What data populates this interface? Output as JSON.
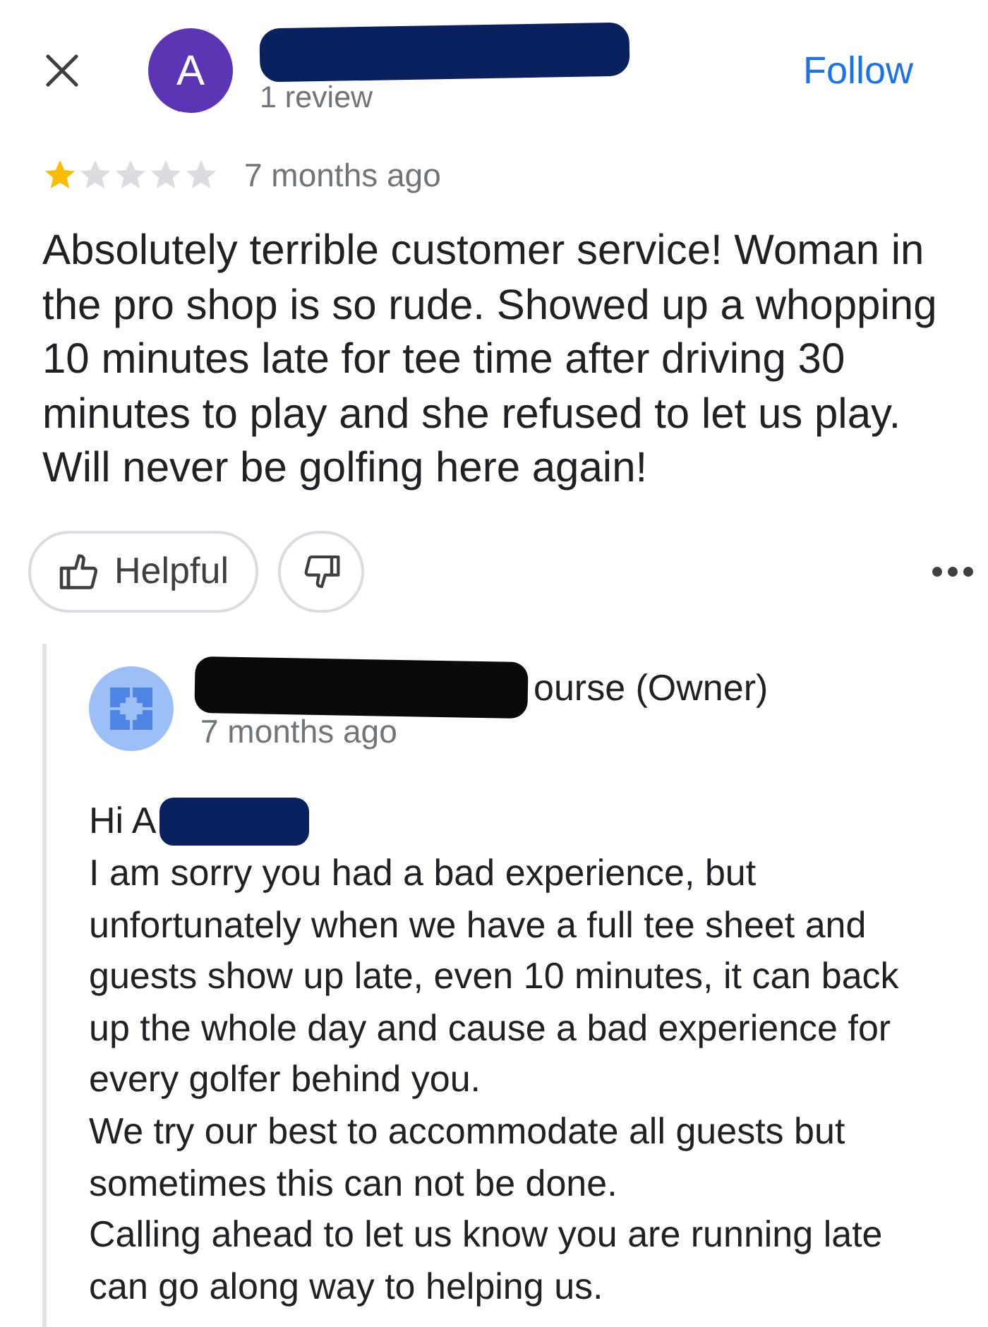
{
  "reviewer": {
    "avatar_letter": "A",
    "review_count": "1 review"
  },
  "follow_button": "Follow",
  "rating": {
    "stars": 1,
    "time": "7 months ago"
  },
  "review_text": "Absolutely terrible customer service! Woman in the pro shop is so rude. Showed up a whopping 10 minutes late for tee time after driving 30 minutes to play and she refused to let us play. Will never be golfing here again!",
  "actions": {
    "helpful_label": "Helpful"
  },
  "owner_reply": {
    "name": "ourse (Owner)",
    "time": "7 months ago",
    "greeting": "Hi A",
    "paragraphs": [
      "I am sorry you had a bad experience, but unfortunately when we have a full tee sheet and guests show up late, even 10 minutes, it can back up the whole day and cause a bad experience for every golfer behind you.",
      "We try our best to accommodate all guests but sometimes this can not be done.",
      "Calling ahead to let us know you are running late can go along way to helping us."
    ]
  }
}
